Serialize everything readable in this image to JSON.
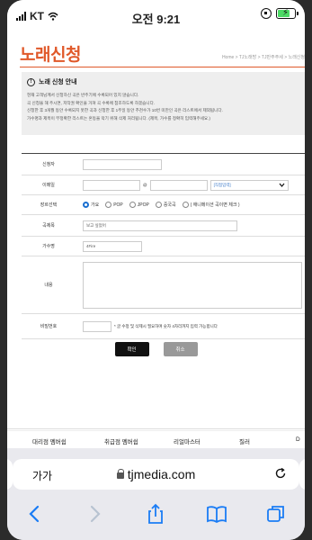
{
  "status": {
    "carrier": "KT",
    "time": "오전 9:21"
  },
  "page": {
    "title": "노래신청",
    "breadcrumb": "Home > TJ노래방 > TJ만주주세 > 노래신청",
    "notice": {
      "heading": "노래 신청 안내",
      "lines": [
        "현재 고객님께서 신청하신 곡은 반주기에 수록되어 있지 않습니다.",
        "곡 신청을 해 주시면, 저작권 확인을 거쳐 곡 수록에 참조하도록 하겠습니다.",
        "신청한 후 3개월 동안 수록되지 못한 곡과 신청한 후 1주일 동안 추천수가 10번 미만인 곡은 리스트에서 제외됩니다.",
        "가수명과 제목이 부정확한 리스트는 혼동을 막기 위해 삭제 처리됩니다. (제목, 가수를 정확히 입력해주세요.)"
      ]
    },
    "form": {
      "applicant_label": "신청자",
      "email_label": "이메일",
      "email_at": "@",
      "email_select": "[직접입력]",
      "genre_label": "장르선택",
      "genres": [
        "가요",
        "POP",
        "JPOP",
        "중국곡",
        "( 애니메이션 곡이면 체크 )"
      ],
      "song_label": "곡제목",
      "song_value": "보고 싶었어",
      "singer_label": "가수명",
      "singer_value": "4Fire",
      "content_label": "내용",
      "password_label": "비밀번호",
      "password_note": "* 글 수정 및 삭제시 필요하며 숫자 4자리까지 입력 가능합니다"
    },
    "buttons": {
      "confirm": "확인",
      "cancel": "취소"
    }
  },
  "footer_nav": [
    "대리점 멤버쉽",
    "취급점 멤버쉽",
    "리얼마스터",
    "질러",
    "D"
  ],
  "browser": {
    "aa": "가가",
    "url": "tjmedia.com"
  }
}
